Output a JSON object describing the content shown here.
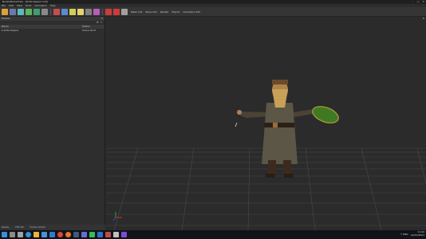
{
  "window": {
    "title": "NoesisModelView - [Kolta Keeper.mdl]",
    "controls": [
      "–",
      "□",
      "✕"
    ]
  },
  "menu": [
    "File",
    "Edit",
    "View",
    "Tools",
    "Animation",
    "Help"
  ],
  "toolbar": {
    "buttons": [
      {
        "icon": "open-folder-icon",
        "color": "#d9a23a"
      },
      {
        "icon": "save-icon",
        "color": "#6b7aa8"
      },
      {
        "icon": "cube-icon",
        "color": "#5fb7c0"
      },
      {
        "icon": "grid-icon",
        "color": "#5cb35c"
      },
      {
        "icon": "mesh-icon",
        "color": "#3c9f6c"
      },
      {
        "icon": "skeleton-icon",
        "color": "#8a8a8a"
      },
      {
        "icon": "select-icon",
        "color": "#c44d4d"
      },
      {
        "icon": "move-icon",
        "color": "#5a8acf"
      },
      {
        "icon": "rotate-icon",
        "color": "#cfcf5a"
      },
      {
        "icon": "light-icon",
        "color": "#e6d36a"
      },
      {
        "icon": "camera-icon",
        "color": "#7f7f7f"
      },
      {
        "icon": "scale-icon",
        "color": "#b95cb9"
      },
      {
        "icon": "play-icon",
        "color": "#cc3b3b"
      },
      {
        "icon": "record-icon",
        "color": "#d23a3a"
      },
      {
        "icon": "stop-icon",
        "color": "#a0a0a0"
      }
    ],
    "text_items": [
      "Mesh Info",
      "Bone Info",
      "Render",
      "Export",
      "Animation Info"
    ]
  },
  "side_panel": {
    "title": "Models",
    "close": "✕",
    "filters": [
      "▼",
      "✕"
    ],
    "columns": [
      "Name",
      "Status"
    ],
    "rows": [
      {
        "name": "▸ Kolta Keeper",
        "status": "Scene Root"
      }
    ]
  },
  "statusbar": [
    "Ready",
    "FPS 60",
    "Frame 0/120"
  ],
  "taskbar": {
    "apps": [
      {
        "icon": "windows-start-icon",
        "color": "#3b8de0"
      },
      {
        "icon": "search-icon",
        "color": "#8a8a8a"
      },
      {
        "icon": "task-view-icon",
        "color": "#a0a0a0"
      },
      {
        "icon": "edge-icon",
        "color": "#2f8fd8"
      },
      {
        "icon": "file-explorer-icon",
        "color": "#e8b53a"
      },
      {
        "icon": "store-icon",
        "color": "#4a8fd8"
      },
      {
        "icon": "mail-icon",
        "color": "#2e7ad1"
      },
      {
        "icon": "chrome-icon",
        "color": "#d84a3a"
      },
      {
        "icon": "firefox-icon",
        "color": "#e8762a"
      },
      {
        "icon": "steam-icon",
        "color": "#3c5a7c"
      },
      {
        "icon": "discord-icon",
        "color": "#6a6ad8"
      },
      {
        "icon": "spotify-icon",
        "color": "#2fbf5a"
      },
      {
        "icon": "photoshop-icon",
        "color": "#2b6fd0"
      },
      {
        "icon": "noesis-icon",
        "color": "#c24a4a"
      },
      {
        "icon": "terminal-icon",
        "color": "#bfbfbf"
      },
      {
        "icon": "game-icon",
        "color": "#7a4ad8"
      }
    ],
    "tray_text": "↑ ENG",
    "time": "11:42",
    "date": "12/21/2021"
  }
}
